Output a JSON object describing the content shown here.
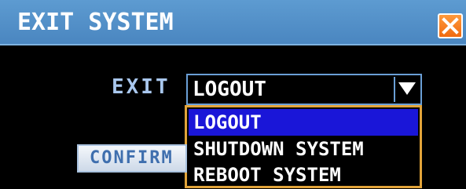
{
  "window": {
    "title": "EXIT SYSTEM"
  },
  "form": {
    "exit_label": "EXIT",
    "selected_value": "LOGOUT",
    "options": [
      "LOGOUT",
      "SHUTDOWN SYSTEM",
      "REBOOT SYSTEM"
    ],
    "selected_index": 0,
    "confirm_label": "CONFIRM"
  },
  "colors": {
    "titlebar": "#4a86c0",
    "background": "#000000",
    "highlight": "#1a16d8",
    "dropdown_border": "#e2a43a",
    "close_button": "#f06a10"
  },
  "icons": {
    "close": "close-icon",
    "dropdown": "triangle-down-icon"
  }
}
